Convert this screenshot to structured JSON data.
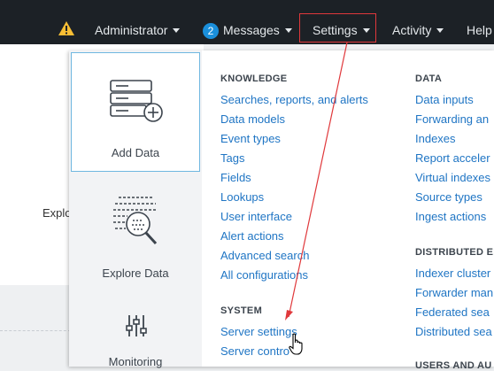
{
  "topbar": {
    "administrator": "Administrator",
    "messages_count": "2",
    "messages": "Messages",
    "settings": "Settings",
    "activity": "Activity",
    "help": "Help"
  },
  "background": {
    "explore_label": "Explo"
  },
  "tiles": {
    "add_data": "Add Data",
    "explore_data": "Explore Data",
    "monitoring": "Monitoring"
  },
  "knowledge": {
    "heading": "KNOWLEDGE",
    "links": [
      "Searches, reports, and alerts",
      "Data models",
      "Event types",
      "Tags",
      "Fields",
      "Lookups",
      "User interface",
      "Alert actions",
      "Advanced search",
      "All configurations"
    ]
  },
  "system": {
    "heading": "SYSTEM",
    "links": [
      "Server settings",
      "Server contro"
    ]
  },
  "data": {
    "heading": "DATA",
    "links": [
      "Data inputs",
      "Forwarding an",
      "Indexes",
      "Report acceler",
      "Virtual indexes",
      "Source types",
      "Ingest actions"
    ]
  },
  "distributed": {
    "heading": "DISTRIBUTED EN",
    "links": [
      "Indexer cluster",
      "Forwarder man",
      "Federated sea",
      "Distributed sea"
    ]
  },
  "users": {
    "heading": "USERS AND AU"
  },
  "colors": {
    "topbar_bg": "#1c2126",
    "link": "#1f75c4",
    "highlight_border": "#e0383b",
    "badge": "#1a8fdb"
  }
}
